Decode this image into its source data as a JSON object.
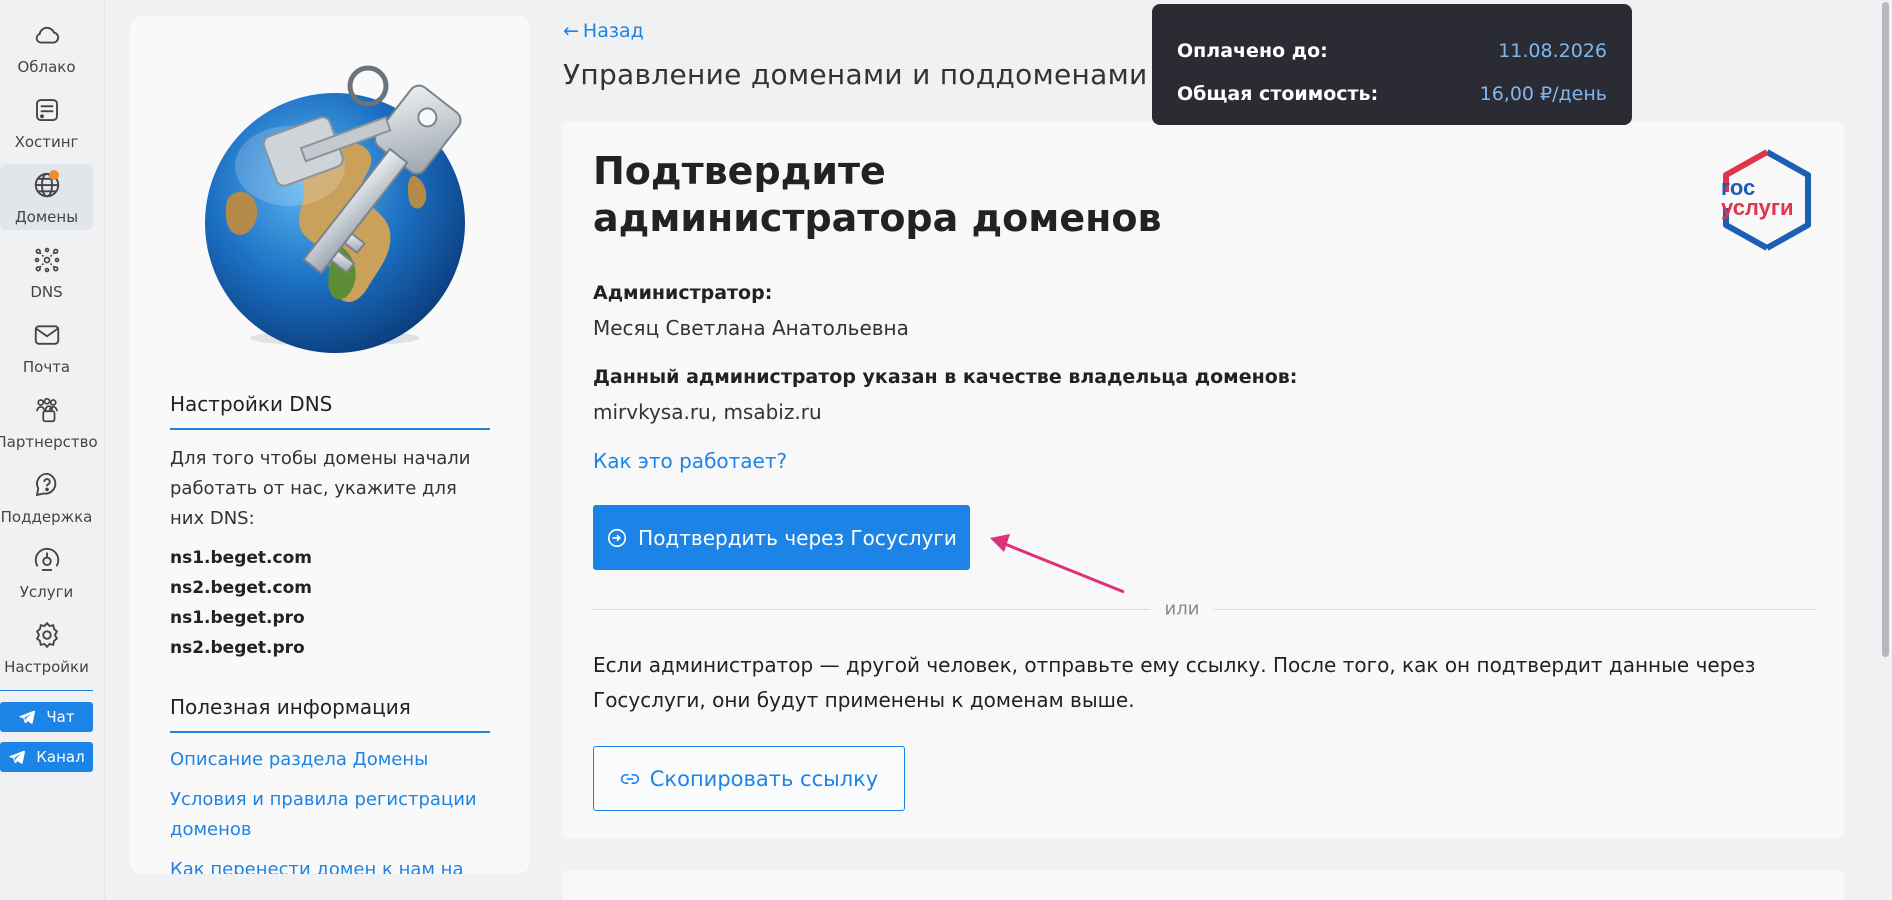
{
  "nav": {
    "items": [
      {
        "label": "Облако",
        "icon": "cloud-icon"
      },
      {
        "label": "Хостинг",
        "icon": "server-icon"
      },
      {
        "label": "Домены",
        "icon": "globe-icon"
      },
      {
        "label": "DNS",
        "icon": "network-icon"
      },
      {
        "label": "Почта",
        "icon": "mail-icon"
      },
      {
        "label": "Партнерство",
        "icon": "partners-icon"
      },
      {
        "label": "Поддержка",
        "icon": "support-icon"
      },
      {
        "label": "Услуги",
        "icon": "services-icon"
      },
      {
        "label": "Настройки",
        "icon": "gear-icon"
      }
    ],
    "chat_label": "Чат",
    "channel_label": "Канал",
    "accent": "#1c84e6",
    "notification_dot_color": "#f28a2e"
  },
  "sidebar": {
    "dns_heading": "Настройки DNS",
    "dns_text": "Для того чтобы домены начали работать от нас, укажите для них DNS:",
    "ns": [
      "ns1.beget.com",
      "ns2.beget.com",
      "ns1.beget.pro",
      "ns2.beget.pro"
    ],
    "info_heading": "Полезная информация",
    "links": [
      "Описание раздела Домены",
      "Условия и правила регистрации доменов",
      "Как перенести домен к нам на"
    ]
  },
  "header": {
    "back_label": "Назад",
    "title": "Управление доменами и поддоменами"
  },
  "tooltip": {
    "paid_until_label": "Оплачено до:",
    "paid_until_value": "11.08.2026",
    "total_cost_label": "Общая стоимость:",
    "total_cost_value": "16,00 ₽/день"
  },
  "card": {
    "title_line1": "Подтвердите",
    "title_line2": "администратора доменов",
    "logo_text_top": "гос",
    "logo_text_bottom": "услуги",
    "admin_label": "Администратор:",
    "admin_name": "Месяц Светлана Анатольевна",
    "owner_label": "Данный администратор указан в качестве владельца доменов:",
    "domains": "mirvkysa.ru, msabiz.ru",
    "how_link": "Как это работает?",
    "confirm_button": "Подтвердить через Госуслуги",
    "or_label": "или",
    "paragraph": "Если администратор — другой человек, отправьте ему ссылку. После того, как он подтвердит данные через Госуслуги, они будут применены к доменам выше.",
    "copy_button": "Скопировать ссылку",
    "arrow_color": "#e0307a"
  }
}
